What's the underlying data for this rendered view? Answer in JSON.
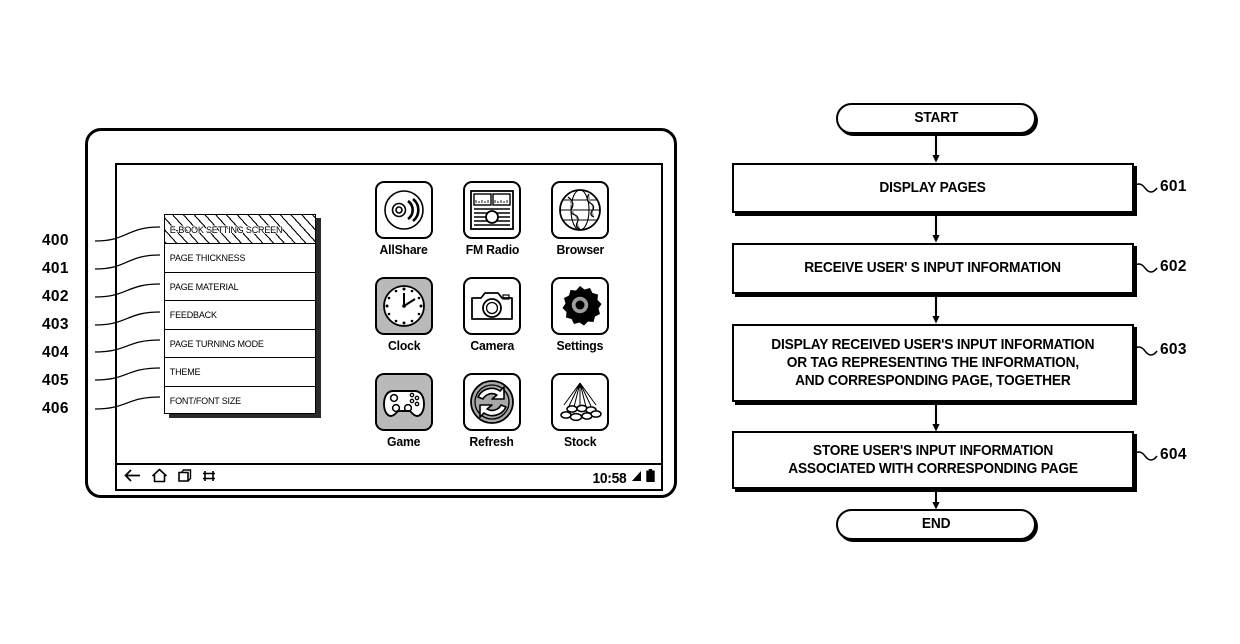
{
  "figure": {
    "left_figure_name": "tablet-device-settings-screen",
    "right_figure_name": "process-flowchart"
  },
  "device": {
    "settings_menu": {
      "header": {
        "label": "E-BOOK SETTING SCREEN",
        "ref": "400",
        "hatched": true
      },
      "items": [
        {
          "label": "PAGE THICKNESS",
          "ref": "401"
        },
        {
          "label": "PAGE MATERIAL",
          "ref": "402"
        },
        {
          "label": "FEEDBACK",
          "ref": "403"
        },
        {
          "label": "PAGE TURNING MODE",
          "ref": "404"
        },
        {
          "label": "THEME",
          "ref": "405"
        },
        {
          "label": "FONT/FONT SIZE",
          "ref": "406"
        }
      ]
    },
    "apps": [
      {
        "label": "AllShare",
        "icon": "allshare-broadcast-icon",
        "shaded": false
      },
      {
        "label": "FM Radio",
        "icon": "fm-radio-icon",
        "shaded": false
      },
      {
        "label": "Browser",
        "icon": "browser-globe-icon",
        "shaded": false
      },
      {
        "label": "Clock",
        "icon": "clock-icon",
        "shaded": true
      },
      {
        "label": "Camera",
        "icon": "camera-icon",
        "shaded": false
      },
      {
        "label": "Settings",
        "icon": "settings-gear-icon",
        "shaded": false
      },
      {
        "label": "Game",
        "icon": "game-controller-icon",
        "shaded": true
      },
      {
        "label": "Refresh",
        "icon": "refresh-icon",
        "shaded": true
      },
      {
        "label": "Stock",
        "icon": "stock-icon",
        "shaded": false
      }
    ],
    "status_bar": {
      "time": "10:58",
      "nav_icons": [
        "back-arrow-icon",
        "home-icon",
        "recent-apps-icon",
        "screenshot-icon"
      ],
      "tray_icons": [
        "signal-icon",
        "battery-icon"
      ]
    }
  },
  "flowchart": {
    "start_label": "START",
    "end_label": "END",
    "steps": [
      {
        "ref": "601",
        "text": "DISPLAY PAGES"
      },
      {
        "ref": "602",
        "text": "RECEIVE USER'  S INPUT INFORMATION"
      },
      {
        "ref": "603",
        "text": "DISPLAY RECEIVED USER'S INPUT INFORMATION\nOR TAG REPRESENTING THE INFORMATION,\nAND CORRESPONDING PAGE, TOGETHER"
      },
      {
        "ref": "604",
        "text": "STORE USER'S INPUT INFORMATION\nASSOCIATED WITH CORRESPONDING PAGE"
      }
    ]
  },
  "colors": {
    "ink": "#000000",
    "background": "#ffffff",
    "icon_shade": "#b9b9b9",
    "panel_shadow": "#2b2b2b"
  }
}
